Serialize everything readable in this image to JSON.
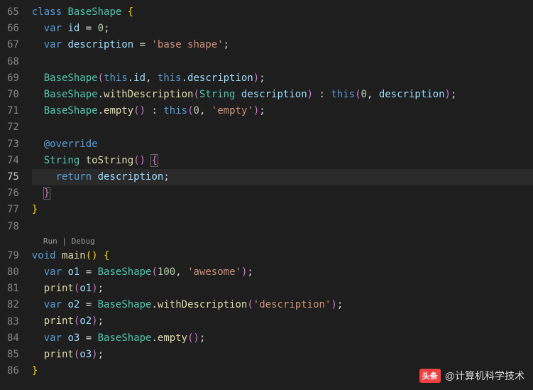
{
  "lines": {
    "start": 65,
    "end": 86,
    "current": 75
  },
  "codelens": {
    "run": "Run",
    "debug": "Debug",
    "sep": " | "
  },
  "code": {
    "l65": {
      "kw_class": "class",
      "cls": "BaseShape",
      "br": "{"
    },
    "l66": {
      "kw_var": "var",
      "name": "id",
      "eq": "=",
      "val": "0",
      "sc": ";"
    },
    "l67": {
      "kw_var": "var",
      "name": "description",
      "eq": "=",
      "val": "'base shape'",
      "sc": ";"
    },
    "l69": {
      "cls": "BaseShape",
      "lp": "(",
      "kw1": "this",
      "d1": ".",
      "f1": "id",
      "c": ", ",
      "kw2": "this",
      "d2": ".",
      "f2": "description",
      "rp": ")",
      "sc": ";"
    },
    "l70": {
      "cls": "BaseShape",
      "d": ".",
      "ctor": "withDescription",
      "lp": "(",
      "ty": "String",
      "arg": "description",
      "rp": ")",
      "col": " : ",
      "kw": "this",
      "lp2": "(",
      "n": "0",
      "c": ", ",
      "v": "description",
      "rp2": ")",
      "sc": ";"
    },
    "l71": {
      "cls": "BaseShape",
      "d": ".",
      "ctor": "empty",
      "lp": "(",
      "rp": ")",
      "col": " : ",
      "kw": "this",
      "lp2": "(",
      "n": "0",
      "c": ", ",
      "s": "'empty'",
      "rp2": ")",
      "sc": ";"
    },
    "l73": {
      "ann": "@override"
    },
    "l74": {
      "ty": "String",
      "fn": "toString",
      "lp": "(",
      "rp": ")",
      "br": "{"
    },
    "l75": {
      "kw": "return",
      "v": "description",
      "sc": ";"
    },
    "l76": {
      "br": "}"
    },
    "l77": {
      "br": "}"
    },
    "l79": {
      "ty": "void",
      "fn": "main",
      "lp": "(",
      "rp": ")",
      "br": "{"
    },
    "l80": {
      "kw": "var",
      "name": "o1",
      "eq": "=",
      "cls": "BaseShape",
      "lp": "(",
      "n": "100",
      "c": ", ",
      "s": "'awesome'",
      "rp": ")",
      "sc": ";"
    },
    "l81": {
      "fn": "print",
      "lp": "(",
      "arg": "o1",
      "rp": ")",
      "sc": ";"
    },
    "l82": {
      "kw": "var",
      "name": "o2",
      "eq": "=",
      "cls": "BaseShape",
      "d": ".",
      "ctor": "withDescription",
      "lp": "(",
      "s": "'description'",
      "rp": ")",
      "sc": ";"
    },
    "l83": {
      "fn": "print",
      "lp": "(",
      "arg": "o2",
      "rp": ")",
      "sc": ";"
    },
    "l84": {
      "kw": "var",
      "name": "o3",
      "eq": "=",
      "cls": "BaseShape",
      "d": ".",
      "ctor": "empty",
      "lp": "(",
      "rp": ")",
      "sc": ";"
    },
    "l85": {
      "fn": "print",
      "lp": "(",
      "arg": "o3",
      "rp": ")",
      "sc": ";"
    },
    "l86": {
      "br": "}"
    }
  },
  "watermark": {
    "logo": "头条",
    "text": "@计算机科学技术"
  }
}
